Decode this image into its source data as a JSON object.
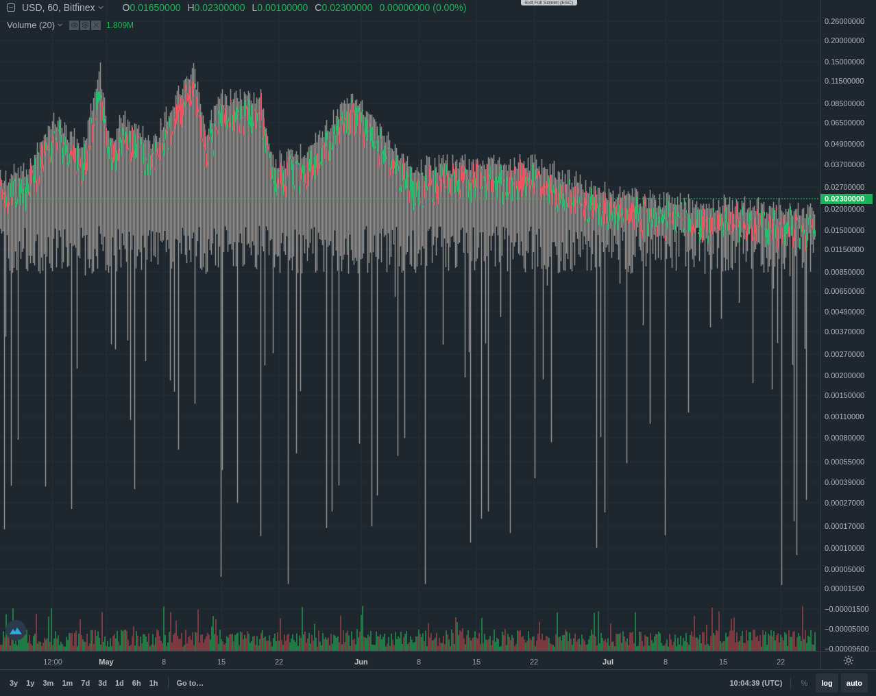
{
  "tooltip": "Exit Full Screen (ESC)",
  "header": {
    "symbol": "USD, 60, Bitfinex",
    "ohlc": [
      {
        "label": "O",
        "value": "0.01650000"
      },
      {
        "label": "H",
        "value": "0.02300000"
      },
      {
        "label": "L",
        "value": "0.00100000"
      },
      {
        "label": "C",
        "value": "0.02300000"
      }
    ],
    "change": "0.00000000 (0.00%)"
  },
  "volume_legend": {
    "label": "Volume (20)",
    "value": "1.809M"
  },
  "price_axis": {
    "labels": [
      "0.26000000",
      "0.20000000",
      "0.15000000",
      "0.11500000",
      "0.08500000",
      "0.06500000",
      "0.04900000",
      "0.03700000",
      "0.02700000",
      "0.02000000",
      "0.01500000",
      "0.01150000",
      "0.00850000",
      "0.00650000",
      "0.00490000",
      "0.00370000",
      "0.00270000",
      "0.00200000",
      "0.00150000",
      "0.00110000",
      "0.00080000",
      "0.00055000",
      "0.00039000",
      "0.00027000",
      "0.00017000",
      "0.00010000",
      "0.00005000",
      "0.00001500",
      "−0.00001500",
      "−0.00005000",
      "−0.00009600"
    ],
    "last_price": "0.02300000"
  },
  "time_axis": [
    {
      "label": "12:00",
      "kind": "time"
    },
    {
      "label": "May",
      "kind": "month"
    },
    {
      "label": "8",
      "kind": "day"
    },
    {
      "label": "15",
      "kind": "day"
    },
    {
      "label": "22",
      "kind": "day"
    },
    {
      "label": "Jun",
      "kind": "month"
    },
    {
      "label": "8",
      "kind": "day"
    },
    {
      "label": "15",
      "kind": "day"
    },
    {
      "label": "22",
      "kind": "day"
    },
    {
      "label": "Jul",
      "kind": "month"
    },
    {
      "label": "8",
      "kind": "day"
    },
    {
      "label": "15",
      "kind": "day"
    },
    {
      "label": "22",
      "kind": "day"
    }
  ],
  "ranges": [
    "3y",
    "1y",
    "3m",
    "1m",
    "7d",
    "3d",
    "1d",
    "6h",
    "1h"
  ],
  "goto": "Go to…",
  "status": {
    "time": "10:04:39 (UTC)",
    "scale_buttons": [
      {
        "label": "%",
        "selected": false
      },
      {
        "label": "log",
        "selected": true
      },
      {
        "label": "auto",
        "selected": true
      }
    ]
  }
}
